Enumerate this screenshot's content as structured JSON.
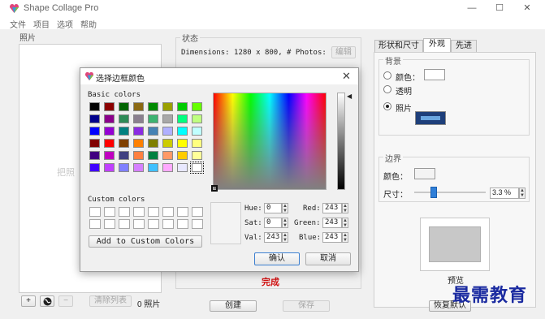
{
  "app": {
    "title": "Shape Collage Pro"
  },
  "menu": [
    "文件",
    "项目",
    "选项",
    "帮助"
  ],
  "window_controls": [
    "—",
    "☐",
    "✕"
  ],
  "photos": {
    "group_label": "照片",
    "drop_hint": "把照",
    "add_label": "+",
    "remove_label": "−",
    "clear_label": "清除列表",
    "count_label": "0 照片"
  },
  "status": {
    "group_label": "状态",
    "info": "Dimensions: 1280 x 800, # Photos: 7",
    "edit_label": "编辑",
    "done_text": "完成",
    "done_color": "#d01010",
    "create_label": "创建",
    "save_label": "保存"
  },
  "tabs": [
    "形状和尺寸",
    "外观",
    "先进"
  ],
  "appearance": {
    "background_label": "背景",
    "color_label": "颜色：",
    "transparent_label": "透明",
    "photo_label": "照片",
    "border_label": "边界",
    "border_color_label": "颜色：",
    "size_label": "尺寸：",
    "size_value": "3.3 %",
    "size_slider_fraction": 0.27,
    "preview_label": "预览",
    "reset_label": "恢复默认"
  },
  "dialog": {
    "title": "选择边框颜色",
    "basic_label": "Basic colors",
    "custom_label": "Custom colors",
    "add_custom_label": "Add to Custom Colors",
    "hue_label": "Hue:",
    "hue": "0",
    "sat_label": "Sat:",
    "sat": "0",
    "val_label": "Val:",
    "val": "243",
    "red_label": "Red:",
    "red": "243",
    "green_label": "Green:",
    "green": "243",
    "blue_label": "Blue:",
    "blue": "243",
    "ok_label": "确认",
    "cancel_label": "取消",
    "current_color": "#f3f3f3",
    "basic_colors": [
      [
        "#000000",
        "#8b0000",
        "#006400",
        "#8b6914",
        "#008b00",
        "#9aa000",
        "#00cc00",
        "#66ff00"
      ],
      [
        "#00008b",
        "#8b008b",
        "#2e8b57",
        "#8a7f8f",
        "#3cb371",
        "#a8a8a8",
        "#00ff7f",
        "#bfff80"
      ],
      [
        "#0000ff",
        "#9400d3",
        "#008080",
        "#8a2be2",
        "#4682b4",
        "#b0b0ff",
        "#00ffff",
        "#c0ffff"
      ],
      [
        "#800000",
        "#ff0000",
        "#804000",
        "#ff8000",
        "#808000",
        "#cccc00",
        "#ffff00",
        "#ffff80"
      ],
      [
        "#400080",
        "#c000c0",
        "#404080",
        "#ff8040",
        "#008040",
        "#ff9966",
        "#ffcc00",
        "#ffff99"
      ],
      [
        "#4000ff",
        "#c040ff",
        "#8080ff",
        "#d580ff",
        "#40c0ff",
        "#ffaaff",
        "#e8e8ff",
        "#ffffff"
      ]
    ]
  },
  "watermark": "最需教育"
}
